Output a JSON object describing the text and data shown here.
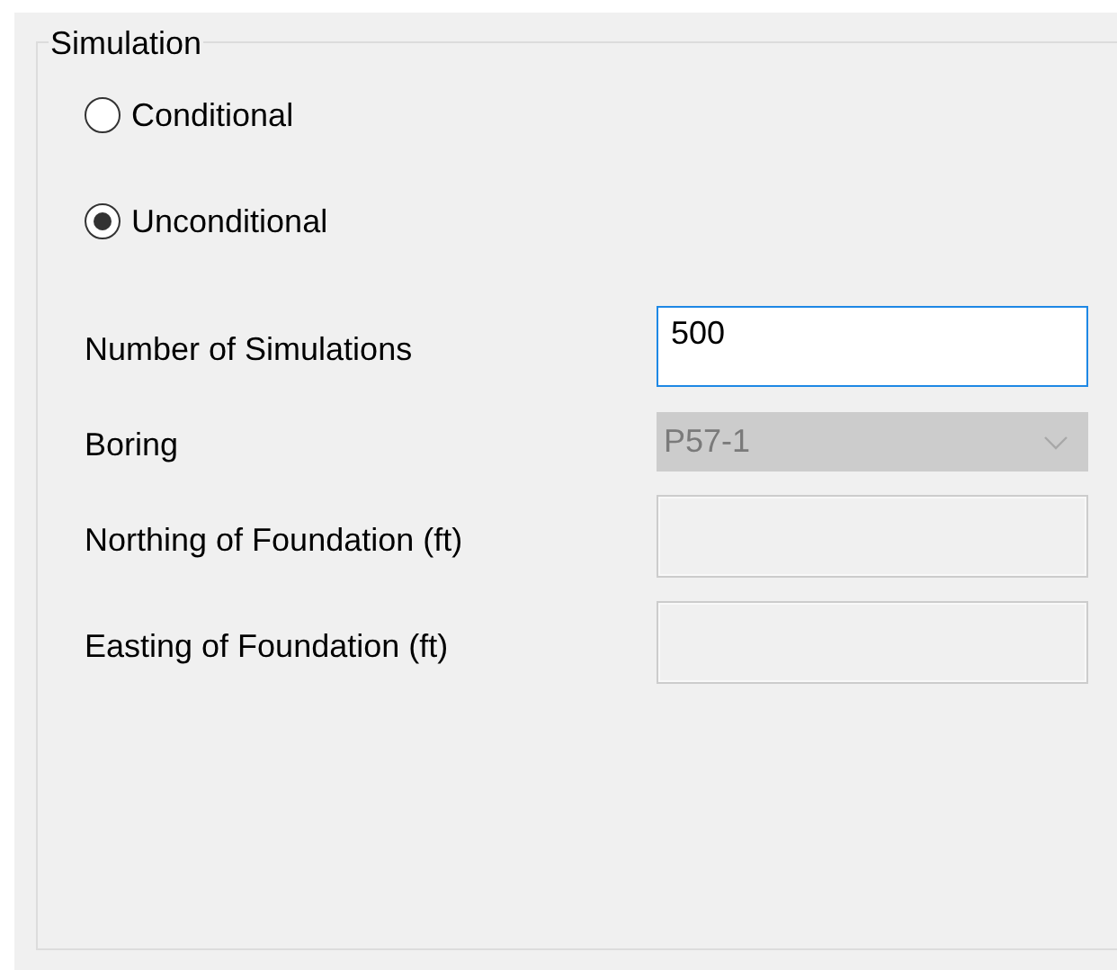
{
  "group": {
    "title": "Simulation"
  },
  "options": [
    {
      "label": "Conditional",
      "selected": false
    },
    {
      "label": "Unconditional",
      "selected": true
    }
  ],
  "fields": [
    {
      "kind": "text",
      "label": "Number of Simulations",
      "value": "500",
      "focused": true,
      "disabled": false
    },
    {
      "kind": "combo",
      "label": "Boring",
      "value": "P57-1",
      "disabled": true
    },
    {
      "kind": "text",
      "label": "Northing of Foundation (ft)",
      "disabled": true
    },
    {
      "kind": "text",
      "label": "Easting of Foundation (ft)",
      "disabled": true
    }
  ]
}
